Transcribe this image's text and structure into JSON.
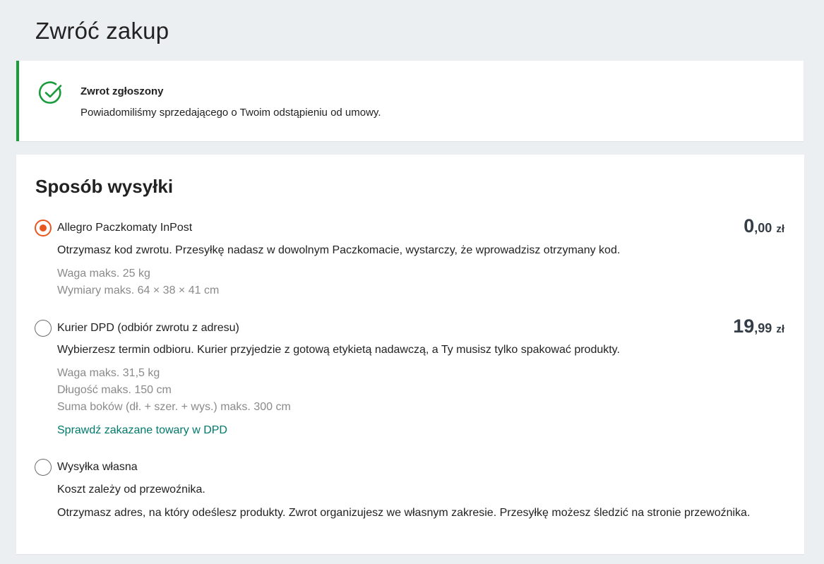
{
  "page": {
    "title": "Zwróć zakup"
  },
  "notice": {
    "title": "Zwrot zgłoszony",
    "text": "Powiadomiliśmy sprzedającego o Twoim odstąpieniu od umowy.",
    "icon": "check-circle-icon",
    "accent_color": "#1a9b3c"
  },
  "shipping": {
    "heading": "Sposób wysyłki",
    "selected_color": "#e8561f",
    "link_color": "#00796b",
    "options": [
      {
        "label": "Allegro Paczkomaty InPost",
        "selected": true,
        "price_int": "0",
        "price_dec": ",00",
        "currency": "zł",
        "description": "Otrzymasz kod zwrotu. Przesyłkę nadasz w dowolnym Paczkomacie, wystarczy, że wprowadzisz otrzymany kod.",
        "specs": [
          "Waga maks. 25 kg",
          "Wymiary maks. 64 × 38 × 41 cm"
        ]
      },
      {
        "label": "Kurier DPD (odbiór zwrotu z adresu)",
        "selected": false,
        "price_int": "19",
        "price_dec": ",99",
        "currency": "zł",
        "description": "Wybierzesz termin odbioru. Kurier przyjedzie z gotową etykietą nadawczą, a Ty musisz tylko spakować produkty.",
        "specs": [
          "Waga maks. 31,5 kg",
          "Długość maks. 150 cm",
          "Suma boków (dł. + szer. + wys.) maks. 300 cm"
        ],
        "link": "Sprawdź zakazane towary w DPD"
      },
      {
        "label": "Wysyłka własna",
        "selected": false,
        "description": "Koszt zależy od przewoźnika.",
        "description2": "Otrzymasz adres, na który odeślesz produkty. Zwrot organizujesz we własnym zakresie. Przesyłkę możesz śledzić na stronie przewoźnika."
      }
    ]
  }
}
